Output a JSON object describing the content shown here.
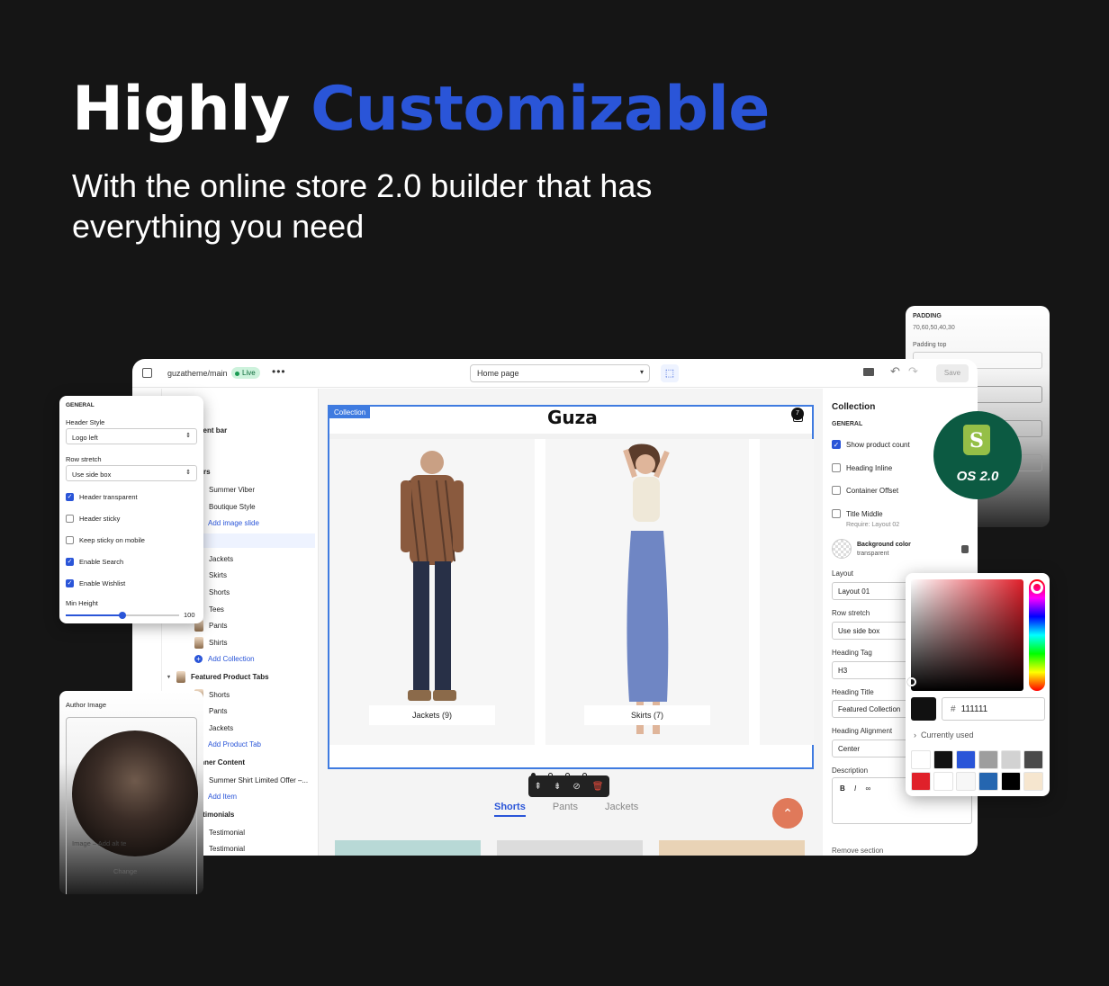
{
  "hero": {
    "title_part1": "Highly",
    "title_part2": "Customizable",
    "subtitle": "With the online store 2.0 builder that has everything you need"
  },
  "padding_panel": {
    "title": "PADDING",
    "value": "70,60,50,40,30",
    "label": "Padding top"
  },
  "topbar": {
    "repo": "guzatheme/main",
    "live": "Live",
    "page": "Home page",
    "save": "Save"
  },
  "tree": {
    "items": [
      {
        "label": "age",
        "kind": "head"
      },
      {
        "label": "nouncement bar",
        "kind": "section"
      },
      {
        "label": "ader",
        "kind": "section"
      },
      {
        "label": "mer Sliders",
        "kind": "section"
      },
      {
        "label": "Summer Viber",
        "kind": "child"
      },
      {
        "label": "Boutique Style",
        "kind": "child"
      },
      {
        "label": "Add image slide",
        "kind": "add"
      },
      {
        "label": "llection",
        "kind": "selected"
      },
      {
        "label": "Jackets",
        "kind": "child"
      },
      {
        "label": "Skirts",
        "kind": "child"
      },
      {
        "label": "Shorts",
        "kind": "child"
      },
      {
        "label": "Tees",
        "kind": "child"
      },
      {
        "label": "Pants",
        "kind": "child"
      },
      {
        "label": "Shirts",
        "kind": "child"
      },
      {
        "label": "Add Collection",
        "kind": "add"
      },
      {
        "label": "Featured Product Tabs",
        "kind": "section"
      },
      {
        "label": "Shorts",
        "kind": "child"
      },
      {
        "label": "Pants",
        "kind": "child"
      },
      {
        "label": "Jackets",
        "kind": "child"
      },
      {
        "label": "Add Product Tab",
        "kind": "add"
      },
      {
        "label": "Banner Content",
        "kind": "section"
      },
      {
        "label": "Summer Shirt Limited Offer –...",
        "kind": "child"
      },
      {
        "label": "Add Item",
        "kind": "add"
      },
      {
        "label": "Testimonials",
        "kind": "section"
      },
      {
        "label": "Testimonial",
        "kind": "child"
      },
      {
        "label": "Testimonial",
        "kind": "child"
      }
    ]
  },
  "store": {
    "tag": "Collection",
    "logo": "Guza",
    "cart_count": "7",
    "cards": [
      {
        "caption": "Jackets (9)"
      },
      {
        "caption": "Skirts (7)"
      }
    ],
    "tabs": [
      "Shorts",
      "Pants",
      "Jackets"
    ],
    "active_tab": "Shorts"
  },
  "settings": {
    "title": "Collection",
    "section": "GENERAL",
    "checks": [
      {
        "label": "Show product count",
        "checked": true
      },
      {
        "label": "Heading Inline",
        "checked": false
      },
      {
        "label": "Container Offset",
        "checked": false
      },
      {
        "label": "Title Middle",
        "checked": false
      }
    ],
    "title_middle_note": "Require: Layout 02",
    "bg_label": "Background color",
    "bg_value": "transparent",
    "layout_label": "Layout",
    "layout_value": "Layout 01",
    "row_stretch_label": "Row stretch",
    "row_stretch_value": "Use side box",
    "heading_tag_label": "Heading Tag",
    "heading_tag_value": "H3",
    "heading_title_label": "Heading Title",
    "heading_title_value": "Featured Collection",
    "heading_align_label": "Heading Alignment",
    "heading_align_value": "Center",
    "description_label": "Description",
    "remove_label": "Remove section"
  },
  "general_panel": {
    "title": "GENERAL",
    "header_style_label": "Header Style",
    "header_style_value": "Logo left",
    "row_stretch_label": "Row stretch",
    "row_stretch_value": "Use side box",
    "checks": [
      {
        "label": "Header transparent",
        "checked": true
      },
      {
        "label": "Header sticky",
        "checked": false
      },
      {
        "label": "Keep sticky on mobile",
        "checked": false
      },
      {
        "label": "Enable Search",
        "checked": true
      },
      {
        "label": "Enable Wishlist",
        "checked": true
      }
    ],
    "min_height_label": "Min Height",
    "min_height_value": "100",
    "min_height_level": 0.5
  },
  "author_panel": {
    "title": "Author Image",
    "meta": "Image – Add alt te",
    "change": "Change"
  },
  "os_badge": {
    "shopify_letter": "S",
    "text": "OS 2.0"
  },
  "color_picker": {
    "hex": "111111",
    "currently_used": "Currently used",
    "swatches": [
      "#ffffff",
      "#111111",
      "#2a55d8",
      "#9e9e9e",
      "#d2d2d2",
      "#4a4a4a",
      "#e0212a",
      "#ffffff",
      "#f7f7f7",
      "#2566b0",
      "#000000",
      "#f6e6cf"
    ]
  },
  "colors": {
    "accent": "#2a55d8",
    "background": "#151515"
  }
}
